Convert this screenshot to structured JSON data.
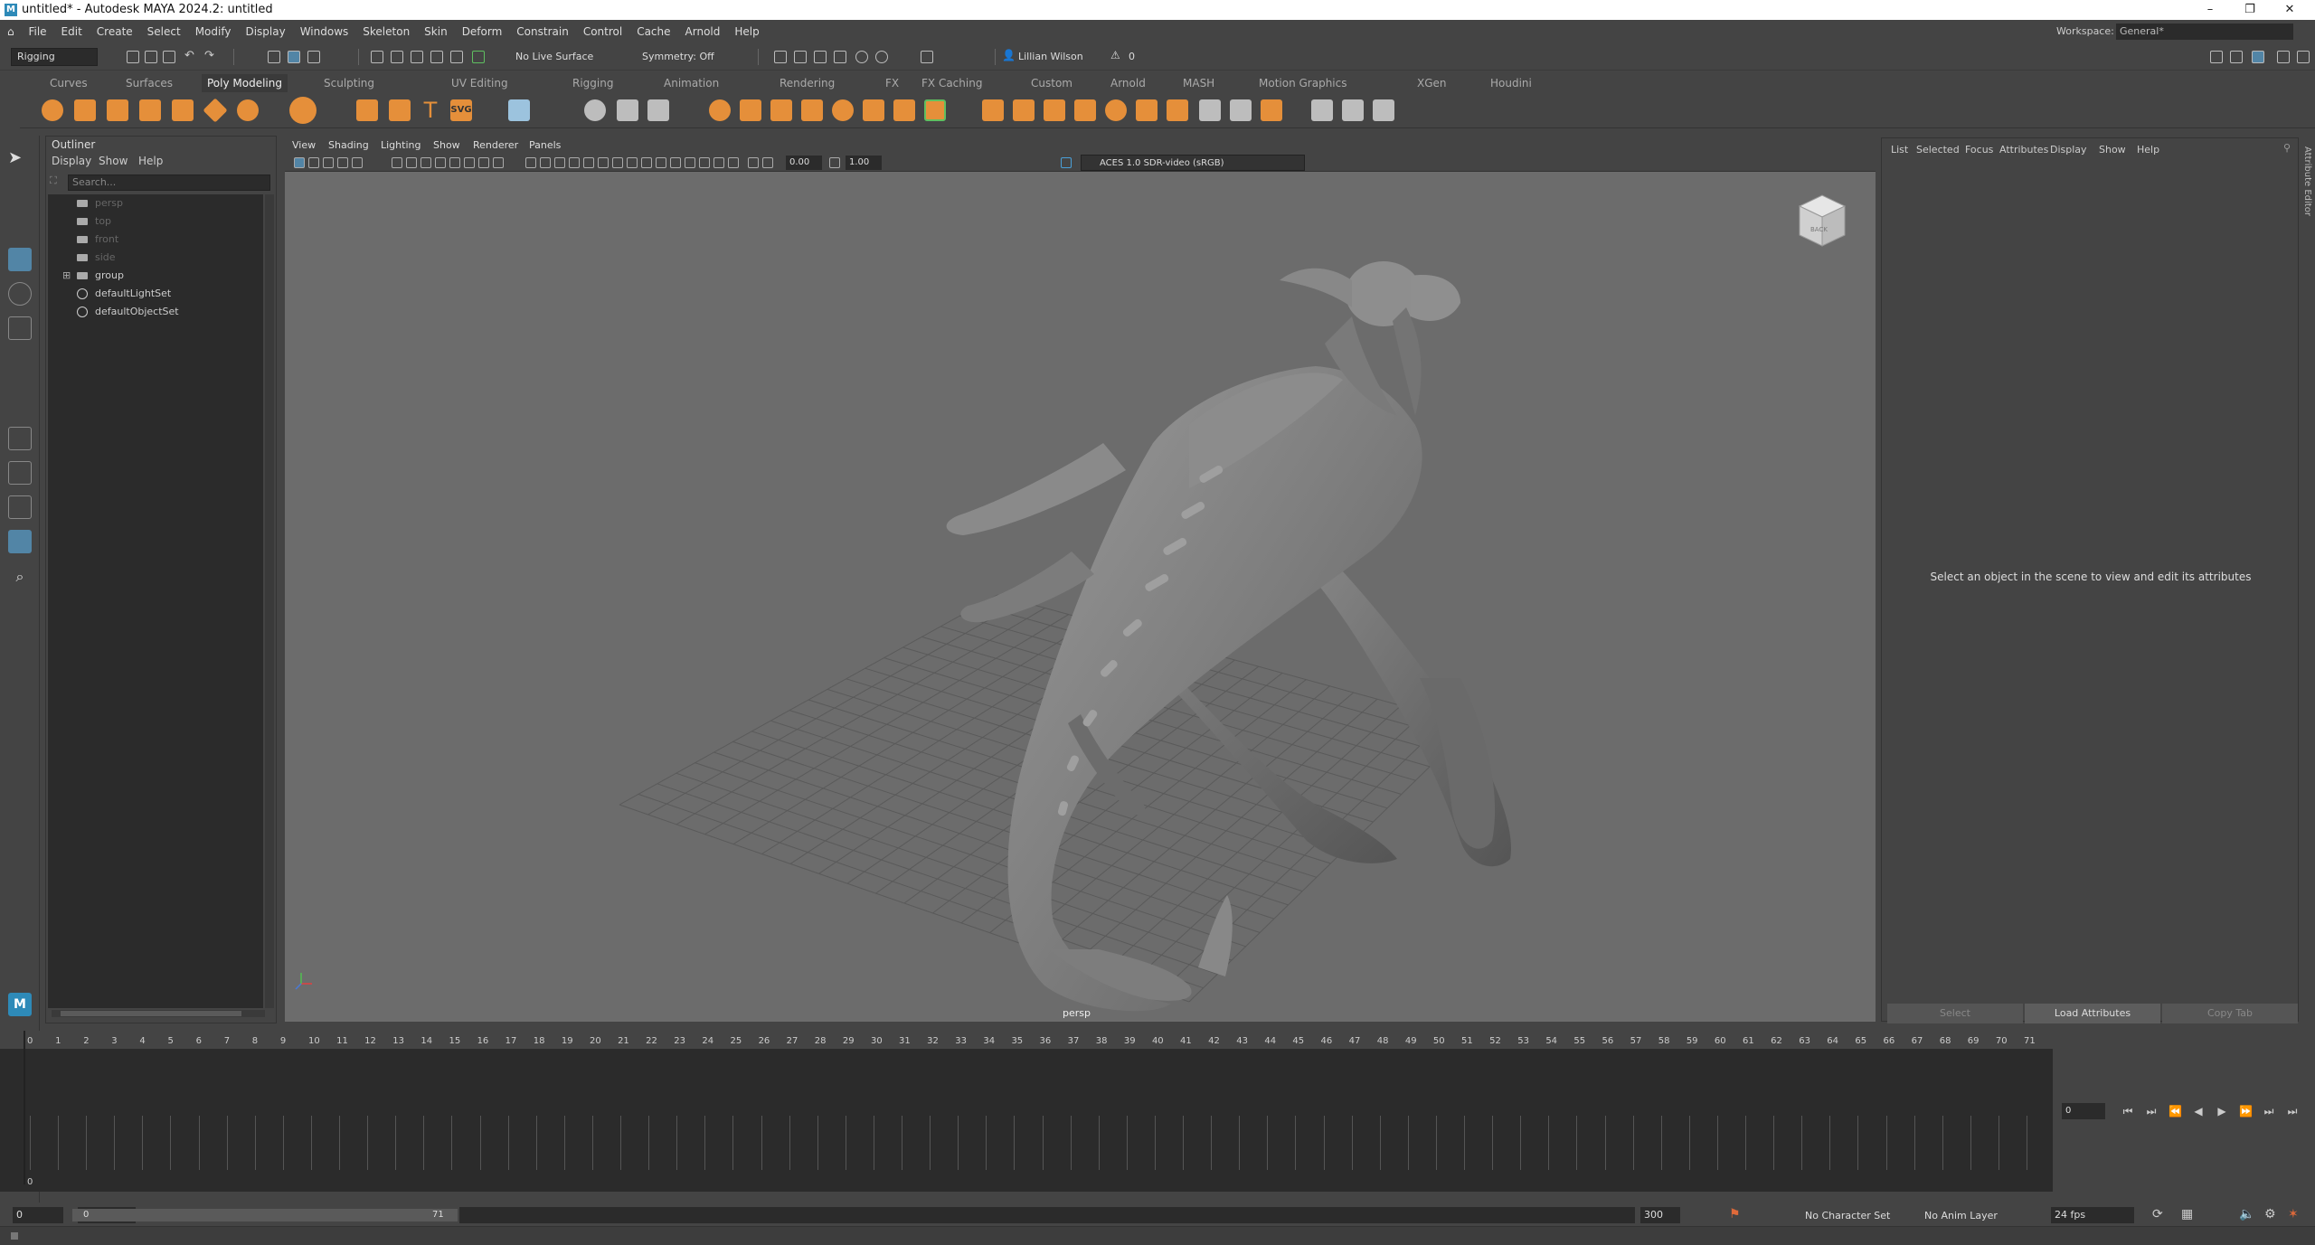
{
  "window": {
    "title": "untitled* - Autodesk MAYA 2024.2: untitled",
    "logo": "M"
  },
  "menus": [
    "File",
    "Edit",
    "Create",
    "Select",
    "Modify",
    "Display",
    "Windows",
    "Skeleton",
    "Skin",
    "Deform",
    "Constrain",
    "Control",
    "Cache",
    "Arnold",
    "Help"
  ],
  "workspace": {
    "label": "Workspace:",
    "value": "General*"
  },
  "toolbar": {
    "mode": "Rigging",
    "live_surface": "No Live Surface",
    "symmetry": "Symmetry: Off",
    "user": "Lillian Wilson",
    "warnings": "0"
  },
  "shelf_tabs": [
    "Curves",
    "Surfaces",
    "Poly Modeling",
    "Sculpting",
    "UV Editing",
    "Rigging",
    "Animation",
    "Rendering",
    "FX",
    "FX Caching",
    "Custom",
    "Arnold",
    "MASH",
    "Motion Graphics",
    "XGen",
    "Houdini"
  ],
  "active_shelf_tab": "Poly Modeling",
  "shelf_svg_label": "SVG",
  "outliner": {
    "title": "Outliner",
    "menus": [
      "Display",
      "Show",
      "Help"
    ],
    "search_placeholder": "Search...",
    "items": [
      {
        "name": "persp",
        "dim": true
      },
      {
        "name": "top",
        "dim": true
      },
      {
        "name": "front",
        "dim": true
      },
      {
        "name": "side",
        "dim": true
      },
      {
        "name": "group",
        "dim": false
      },
      {
        "name": "defaultLightSet",
        "dim": false
      },
      {
        "name": "defaultObjectSet",
        "dim": false
      }
    ]
  },
  "viewport": {
    "menus": [
      "View",
      "Shading",
      "Lighting",
      "Show",
      "Renderer",
      "Panels"
    ],
    "field1": "0.00",
    "field2": "1.00",
    "color_space": "ACES 1.0 SDR-video (sRGB)",
    "camera": "persp",
    "cube_face": "BACK"
  },
  "attribute_editor": {
    "menus": [
      "List",
      "Selected",
      "Focus",
      "Attributes",
      "Display",
      "Show",
      "Help"
    ],
    "message": "Select an object in the scene to view and edit its attributes",
    "buttons": [
      "Select",
      "Load Attributes",
      "Copy Tab"
    ],
    "side_label": "Attribute Editor"
  },
  "timeline": {
    "start": 0,
    "end": 71,
    "current": "0"
  },
  "range": {
    "start": "0",
    "inner_start": "0",
    "inner_end": "71",
    "end": "300",
    "character_set": "No Character Set",
    "anim_layer": "No Anim Layer",
    "fps": "24 fps"
  }
}
